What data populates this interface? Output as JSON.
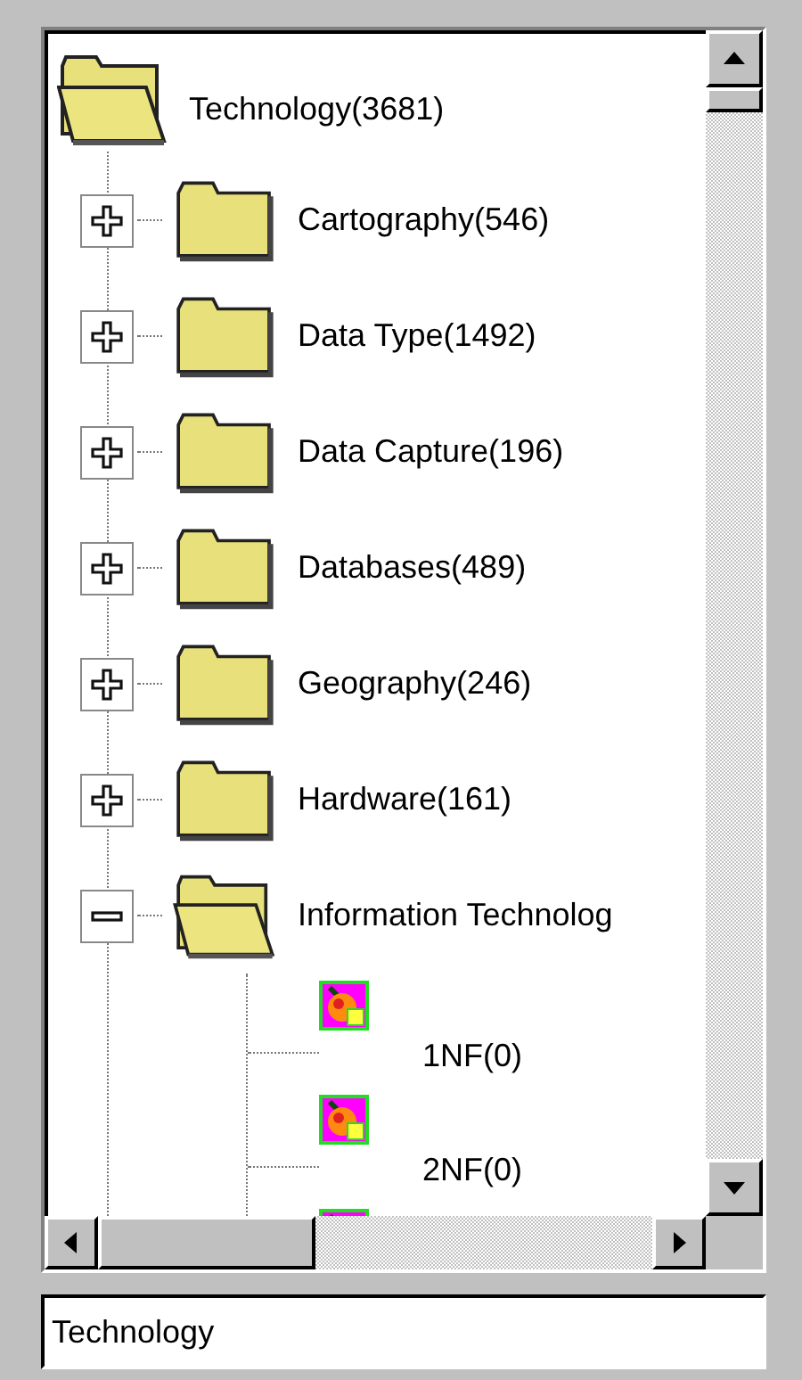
{
  "tree": {
    "label": "Technology(3681)",
    "expanded": true,
    "children": [
      {
        "label": "Cartography(546)",
        "expanded": false
      },
      {
        "label": "Data Type(1492)",
        "expanded": false
      },
      {
        "label": "Data Capture(196)",
        "expanded": false
      },
      {
        "label": "Databases(489)",
        "expanded": false
      },
      {
        "label": "Geography(246)",
        "expanded": false
      },
      {
        "label": "Hardware(161)",
        "expanded": false
      },
      {
        "label": "Information Technolog",
        "expanded": true,
        "children": [
          {
            "kind": "leaf",
            "label": "1NF(0)"
          },
          {
            "kind": "leaf",
            "label": "2NF(0)"
          },
          {
            "kind": "leaf"
          }
        ]
      }
    ]
  },
  "path_field": {
    "value": "Technology"
  }
}
